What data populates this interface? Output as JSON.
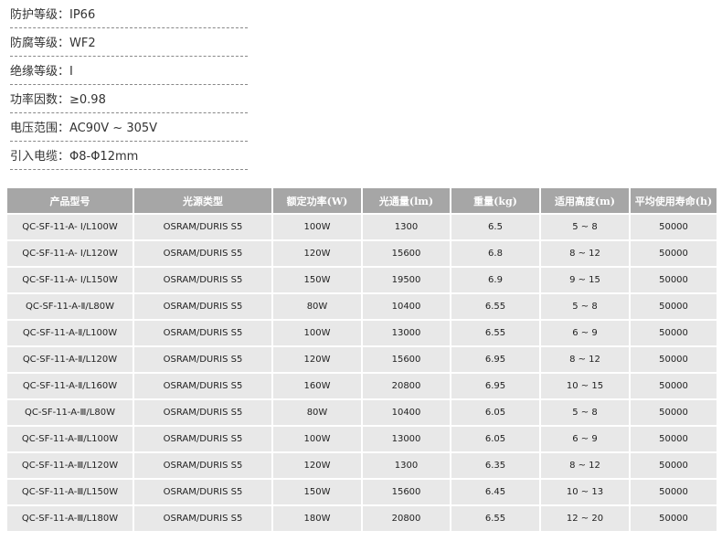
{
  "specs": [
    {
      "label": "防护等级：IP66"
    },
    {
      "label": "防腐等级：WF2"
    },
    {
      "label": "绝缘等级：I"
    },
    {
      "label": "功率因数：≥0.98"
    },
    {
      "label": "电压范围：AC90V ~ 305V"
    },
    {
      "label": "引入电缆：Φ8-Φ12mm"
    }
  ],
  "table": {
    "headers": [
      "产品型号",
      "光源类型",
      "额定功率(W)",
      "光通量(lm)",
      "重量(kg)",
      "适用高度(m)",
      "平均使用寿命(h)"
    ],
    "rows": [
      [
        "QC-SF-11-A- Ⅰ/L100W",
        "OSRAM/DURIS S5",
        "100W",
        "1300",
        "6.5",
        "5 ~ 8",
        "50000"
      ],
      [
        "QC-SF-11-A- Ⅰ/L120W",
        "OSRAM/DURIS S5",
        "120W",
        "15600",
        "6.8",
        "8 ~ 12",
        "50000"
      ],
      [
        "QC-SF-11-A- Ⅰ/L150W",
        "OSRAM/DURIS S5",
        "150W",
        "19500",
        "6.9",
        "9 ~ 15",
        "50000"
      ],
      [
        "QC-SF-11-A-Ⅱ/L80W",
        "OSRAM/DURIS S5",
        "80W",
        "10400",
        "6.55",
        "5 ~ 8",
        "50000"
      ],
      [
        "QC-SF-11-A-Ⅱ/L100W",
        "OSRAM/DURIS S5",
        "100W",
        "13000",
        "6.55",
        "6 ~ 9",
        "50000"
      ],
      [
        "QC-SF-11-A-Ⅱ/L120W",
        "OSRAM/DURIS S5",
        "120W",
        "15600",
        "6.95",
        "8 ~ 12",
        "50000"
      ],
      [
        "QC-SF-11-A-Ⅱ/L160W",
        "OSRAM/DURIS S5",
        "160W",
        "20800",
        "6.95",
        "10 ~ 15",
        "50000"
      ],
      [
        "QC-SF-11-A-Ⅲ/L80W",
        "OSRAM/DURIS S5",
        "80W",
        "10400",
        "6.05",
        "5 ~ 8",
        "50000"
      ],
      [
        "QC-SF-11-A-Ⅲ/L100W",
        "OSRAM/DURIS S5",
        "100W",
        "13000",
        "6.05",
        "6 ~ 9",
        "50000"
      ],
      [
        "QC-SF-11-A-Ⅲ/L120W",
        "OSRAM/DURIS S5",
        "120W",
        "1300",
        "6.35",
        "8 ~ 12",
        "50000"
      ],
      [
        "QC-SF-11-A-Ⅲ/L150W",
        "OSRAM/DURIS S5",
        "150W",
        "15600",
        "6.45",
        "10 ~ 13",
        "50000"
      ],
      [
        "QC-SF-11-A-Ⅲ/L180W",
        "OSRAM/DURIS S5",
        "180W",
        "20800",
        "6.55",
        "12 ~ 20",
        "50000"
      ]
    ]
  },
  "colors": {
    "header_bg": "#a6a6a6",
    "cell_bg": "#e8e8e8",
    "text": "#333333"
  }
}
